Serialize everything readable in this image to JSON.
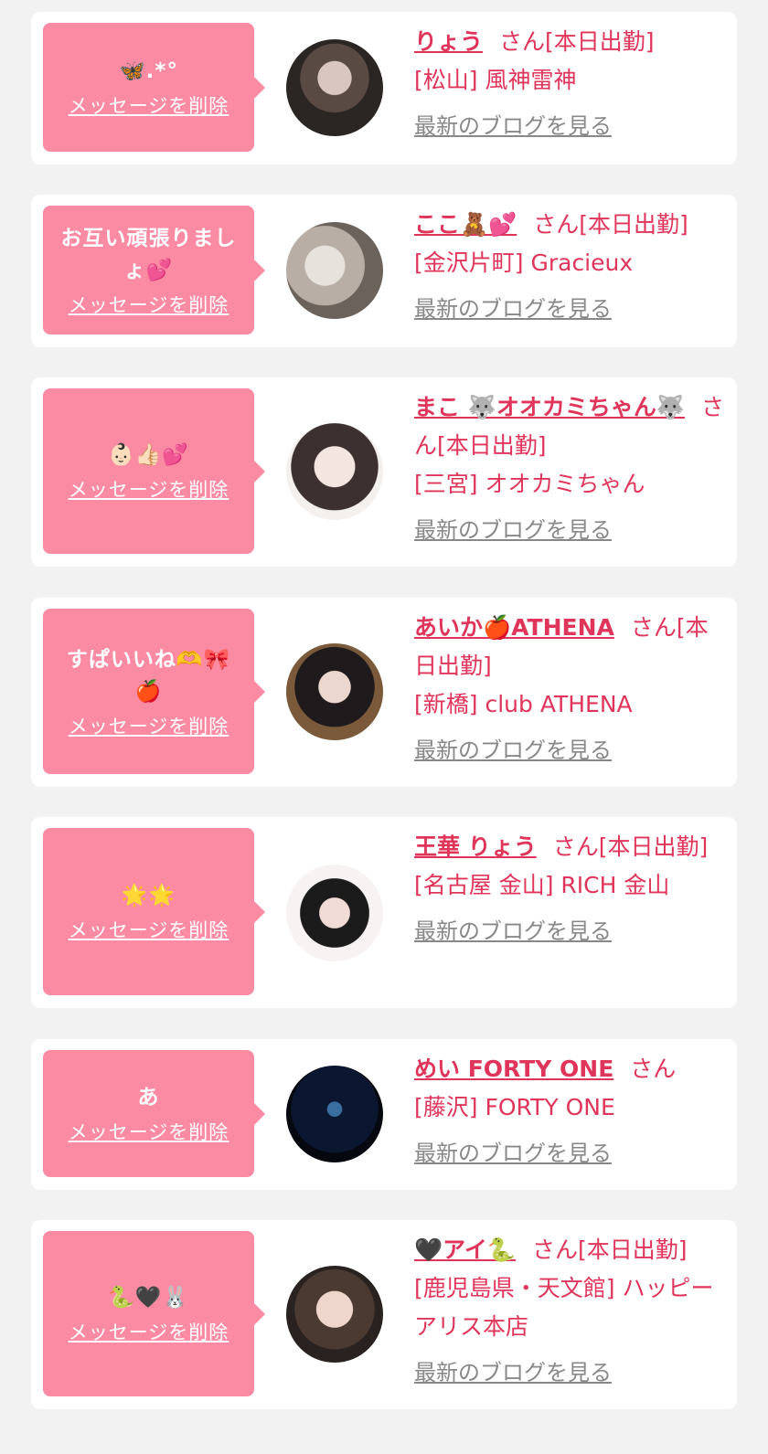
{
  "entries": [
    {
      "message": "🦋.*°",
      "delete_label": "メッセージを削除",
      "name": "りょう",
      "honorific": "さん",
      "status": "[本日出勤]",
      "area": "[松山]",
      "shop": "風神雷神",
      "blog_label": "最新のブログを見る"
    },
    {
      "message": "お互い頑張りましょ💕",
      "delete_label": "メッセージを削除",
      "name": "ここ🧸💕",
      "honorific": "さん",
      "status": "[本日出勤]",
      "area": "[金沢片町]",
      "shop": "Gracieux",
      "blog_label": "最新のブログを見る"
    },
    {
      "message": "👶🏻👍🏻💕",
      "delete_label": "メッセージを削除",
      "name": "まこ 🐺オオカミちゃん🐺",
      "honorific": "さん",
      "status": "[本日出勤]",
      "area": "[三宮]",
      "shop": "オオカミちゃん",
      "blog_label": "最新のブログを見る"
    },
    {
      "message": "すぱいいね🫶🎀🍎",
      "delete_label": "メッセージを削除",
      "name": "あいか🍎ATHENA",
      "honorific": "さん",
      "status": "[本日出勤]",
      "area": "[新橋]",
      "shop": "club ATHENA",
      "blog_label": "最新のブログを見る"
    },
    {
      "message": "🌟🌟",
      "delete_label": "メッセージを削除",
      "name": "王華 りょう",
      "honorific": "さん",
      "status": "[本日出勤]",
      "area": "[名古屋 金山]",
      "shop": "RICH 金山",
      "blog_label": "最新のブログを見る"
    },
    {
      "message": "あ",
      "delete_label": "メッセージを削除",
      "name": "めい FORTY ONE",
      "honorific": "さん",
      "status": "",
      "area": "[藤沢]",
      "shop": "FORTY ONE",
      "blog_label": "最新のブログを見る"
    },
    {
      "message": "🐍🖤🐰",
      "delete_label": "メッセージを削除",
      "name": "🖤アイ🐍",
      "honorific": "さん",
      "status": "[本日出勤]",
      "area": "[鹿児島県・天文館]",
      "shop": "ハッピーアリス本店",
      "blog_label": "最新のブログを見る"
    }
  ],
  "colors": {
    "bubble": "#fb8ba2",
    "accent_text": "#e0355a",
    "link_gray": "#888888",
    "background": "#f2f2f2"
  }
}
